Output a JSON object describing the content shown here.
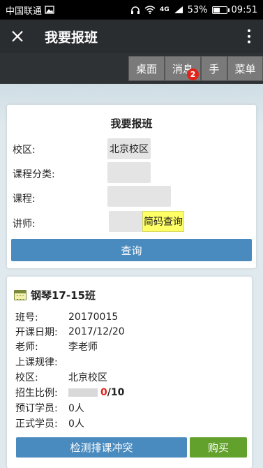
{
  "status": {
    "carrier": "中国联通",
    "network": "4G",
    "battery": "53%",
    "battery_level": 0.53,
    "time": "09:51"
  },
  "titlebar": {
    "title": "我要报班"
  },
  "nav": {
    "items": [
      {
        "label": "桌面"
      },
      {
        "label": "消息",
        "badge": "2"
      },
      {
        "label": "手"
      },
      {
        "label": "菜单"
      }
    ]
  },
  "form": {
    "title": "我要报班",
    "campus_label": "校区:",
    "campus_value": "北京校区",
    "category_label": "课程分类:",
    "course_label": "课程:",
    "teacher_label": "讲师:",
    "code_query_label": "简码查询",
    "query_button": "查询"
  },
  "course": {
    "name": "钢琴17-15班",
    "rows": [
      {
        "k": "班号:",
        "v": "20170015"
      },
      {
        "k": "开课日期:",
        "v": "2017/12/20"
      },
      {
        "k": "老师:",
        "v": "李老师"
      },
      {
        "k": "上课规律:",
        "v": ""
      },
      {
        "k": "校区:",
        "v": "北京校区"
      }
    ],
    "ratio_label": "招生比例:",
    "ratio_enrolled": "0",
    "ratio_total": "/10",
    "reserved_label": "预订学员:",
    "reserved_value": "0人",
    "formal_label": "正式学员:",
    "formal_value": "0人",
    "check_button": "检测排课冲突",
    "buy_button": "购买"
  },
  "colors": {
    "title_bg": "#2a2d30",
    "nav_btn": "#7a7a7a",
    "primary": "#4a8bbf",
    "buy": "#62a12c",
    "badge": "#e2231a",
    "highlight": "#ffff66"
  }
}
